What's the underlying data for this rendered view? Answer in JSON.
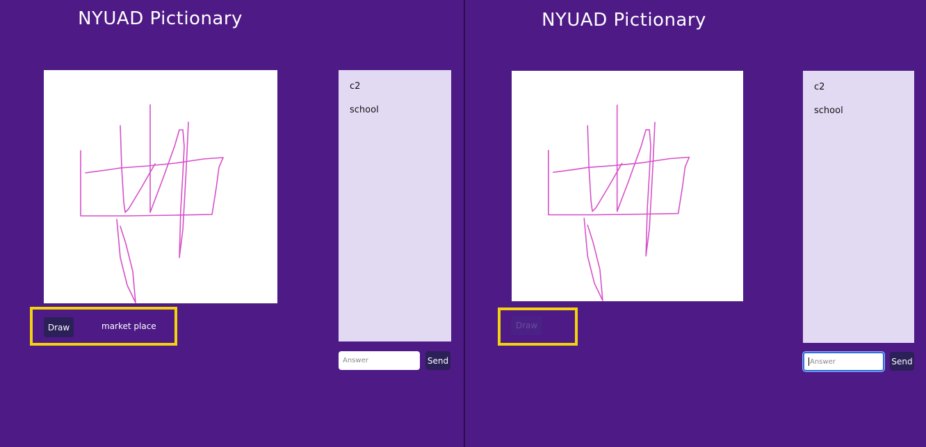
{
  "app": {
    "title": "NYUAD Pictionary"
  },
  "chat": {
    "messages": [
      "c2",
      "school"
    ]
  },
  "controls": {
    "draw_label": "Draw",
    "word": "market place"
  },
  "answer": {
    "placeholder": "Answer",
    "send_label": "Send"
  },
  "colors": {
    "background": "#4d1a86",
    "chat_bg": "#e2d9f3",
    "button": "#2c2058",
    "highlight": "#f5d20e",
    "stroke": "#d64fc8"
  }
}
